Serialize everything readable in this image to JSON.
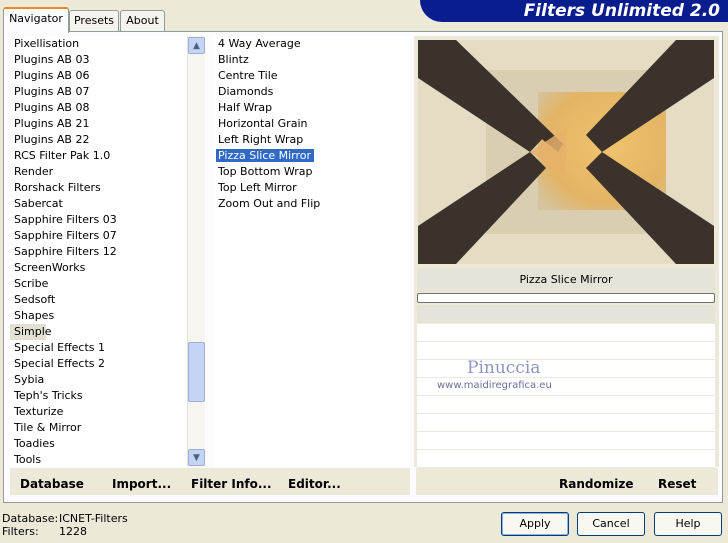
{
  "title": "Filters Unlimited 2.0",
  "tabs": [
    {
      "label": "Navigator",
      "active": true
    },
    {
      "label": "Presets",
      "active": false
    },
    {
      "label": "About",
      "active": false
    }
  ],
  "categories": {
    "items": [
      "Pixellisation",
      "Plugins AB 03",
      "Plugins AB 06",
      "Plugins AB 07",
      "Plugins AB 08",
      "Plugins AB 21",
      "Plugins AB 22",
      "RCS Filter Pak 1.0",
      "Render",
      "Rorshack Filters",
      "Sabercat",
      "Sapphire Filters 03",
      "Sapphire Filters 07",
      "Sapphire Filters 12",
      "ScreenWorks",
      "Scribe",
      "Sedsoft",
      "Shapes",
      "Simple",
      "Special Effects 1",
      "Special Effects 2",
      "Sybia",
      "Teph's Tricks",
      "Texturize",
      "Tile & Mirror",
      "Toadies",
      "Tools"
    ],
    "selected": "Simple"
  },
  "filters": {
    "items": [
      "4 Way Average",
      "Blintz",
      "Centre Tile",
      "Diamonds",
      "Half Wrap",
      "Horizontal Grain",
      "Left Right Wrap",
      "Pizza Slice Mirror",
      "Top Bottom Wrap",
      "Top Left Mirror",
      "Zoom Out and Flip"
    ],
    "selected": "Pizza Slice Mirror"
  },
  "preview": {
    "filter_name": "Pizza Slice Mirror",
    "colors": {
      "background": "#e6dcc4",
      "dark": "#3a322b",
      "gold": "#e9b866"
    }
  },
  "watermark": {
    "name": "Pinuccia",
    "url": "www.maidiregrafica.eu"
  },
  "actions": {
    "database": "Database",
    "import": "Import...",
    "filter_info": "Filter Info...",
    "editor": "Editor...",
    "randomize": "Randomize",
    "reset": "Reset"
  },
  "status": {
    "database_label": "Database:",
    "database_value": "ICNET-Filters",
    "filters_label": "Filters:",
    "filters_value": "1228"
  },
  "buttons": {
    "apply": "Apply",
    "cancel": "Cancel",
    "help": "Help"
  }
}
